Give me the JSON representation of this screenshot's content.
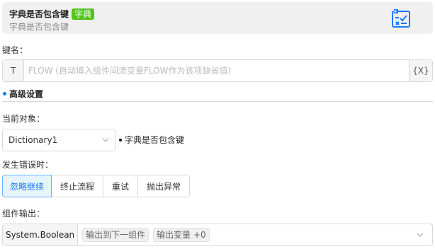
{
  "header": {
    "title": "字典是否包含键",
    "badge": "字典",
    "subtitle": "字典是否包含键",
    "icon": "dictionary-check-icon",
    "accent": "#1677ff",
    "badge_color": "#52c41a"
  },
  "key_field": {
    "label": "键名：",
    "prefix": "T",
    "value": "",
    "placeholder": "FLOW (自动填入组件间流变量FLOW作为该项缺省值)",
    "suffix": "{X}"
  },
  "advanced": {
    "title": "高级设置"
  },
  "current_object": {
    "label": "当前对象：",
    "value": "Dictionary1",
    "note": "字典是否包含键"
  },
  "on_error": {
    "label": "发生错误时：",
    "options": [
      "忽略继续",
      "终止流程",
      "重试",
      "抛出异常"
    ],
    "selected": "忽略继续"
  },
  "output": {
    "label": "组件输出：",
    "type": "System.Boolean",
    "tags": [
      "输出到下一组件",
      "输出变量 +0"
    ]
  }
}
